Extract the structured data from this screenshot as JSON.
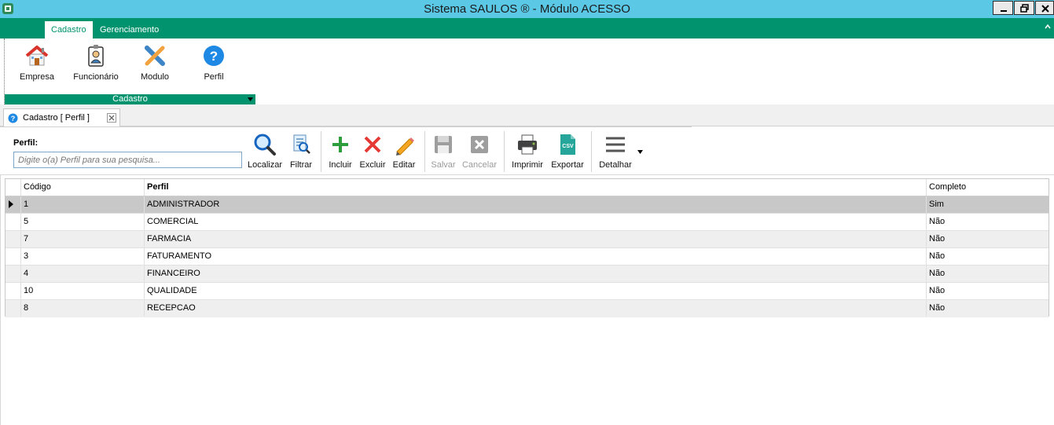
{
  "window": {
    "title": "Sistema SAULOS ® - Módulo ACESSO"
  },
  "ribbon": {
    "tabs": [
      {
        "label": "Cadastro",
        "active": true
      },
      {
        "label": "Gerenciamento",
        "active": false
      }
    ],
    "group": {
      "label": "Cadastro",
      "buttons": [
        {
          "label": "Empresa",
          "icon": "house-icon"
        },
        {
          "label": "Funcionário",
          "icon": "id-badge-icon"
        },
        {
          "label": "Modulo",
          "icon": "tools-icon"
        },
        {
          "label": "Perfil",
          "icon": "help-question-icon"
        }
      ]
    }
  },
  "document_tab": {
    "title": "Cadastro [ Perfil ]"
  },
  "search": {
    "label": "Perfil:",
    "placeholder": "Digite o(a) Perfil para sua pesquisa...",
    "value": ""
  },
  "toolbar": {
    "buttons": [
      {
        "label": "Localizar",
        "icon": "magnifier-icon",
        "enabled": true
      },
      {
        "label": "Filtrar",
        "icon": "filter-document-icon",
        "enabled": true
      },
      {
        "label": "Incluir",
        "icon": "plus-icon",
        "enabled": true
      },
      {
        "label": "Excluir",
        "icon": "x-delete-icon",
        "enabled": true
      },
      {
        "label": "Editar",
        "icon": "pencil-icon",
        "enabled": true
      },
      {
        "label": "Salvar",
        "icon": "floppy-disk-icon",
        "enabled": false
      },
      {
        "label": "Cancelar",
        "icon": "cancel-box-icon",
        "enabled": false
      },
      {
        "label": "Imprimir",
        "icon": "printer-icon",
        "enabled": true
      },
      {
        "label": "Exportar",
        "icon": "csv-file-icon",
        "enabled": true
      },
      {
        "label": "Detalhar",
        "icon": "hamburger-menu-icon",
        "enabled": true
      }
    ]
  },
  "grid": {
    "columns": [
      "Código",
      "Perfil",
      "Completo"
    ],
    "rows": [
      {
        "codigo": "1",
        "perfil": "ADMINISTRADOR",
        "completo": "Sim"
      },
      {
        "codigo": "5",
        "perfil": "COMERCIAL",
        "completo": "Não"
      },
      {
        "codigo": "7",
        "perfil": "FARMACIA",
        "completo": "Não"
      },
      {
        "codigo": "3",
        "perfil": "FATURAMENTO",
        "completo": "Não"
      },
      {
        "codigo": "4",
        "perfil": "FINANCEIRO",
        "completo": "Não"
      },
      {
        "codigo": "10",
        "perfil": "QUALIDADE",
        "completo": "Não"
      },
      {
        "codigo": "8",
        "perfil": "RECEPCAO",
        "completo": "Não"
      }
    ],
    "selected_row": 0
  },
  "colors": {
    "titlebar": "#5bc9e6",
    "ribbon_green": "#00936d",
    "selected_row": "#c8c8c8"
  }
}
